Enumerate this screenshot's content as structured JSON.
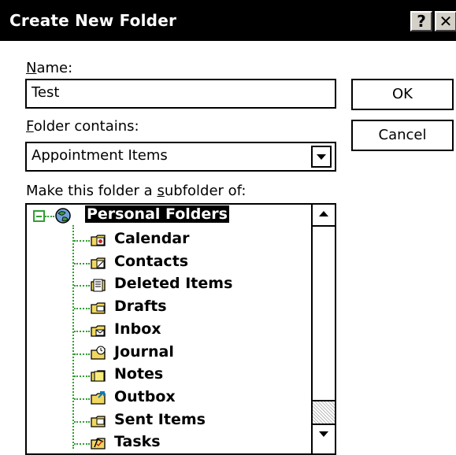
{
  "window": {
    "title": "Create New Folder",
    "help_glyph": "?",
    "close_glyph": "✕"
  },
  "name_field": {
    "label_accel": "N",
    "label_rest": "ame:",
    "value": "Test"
  },
  "contains": {
    "label_accel": "F",
    "label_rest": "older contains:",
    "value": "Appointment Items"
  },
  "subfolder": {
    "label_pre": "Make this folder a ",
    "label_accel": "s",
    "label_rest": "ubfolder of:"
  },
  "buttons": {
    "ok": "OK",
    "cancel": "Cancel"
  },
  "tree": {
    "root": {
      "label": "Personal Folders",
      "icon": "personal-folders-icon"
    },
    "items": [
      {
        "label": "Calendar",
        "icon": "calendar-icon"
      },
      {
        "label": "Contacts",
        "icon": "contacts-icon"
      },
      {
        "label": "Deleted Items",
        "icon": "deleted-items-icon"
      },
      {
        "label": "Drafts",
        "icon": "drafts-icon"
      },
      {
        "label": "Inbox",
        "icon": "inbox-icon"
      },
      {
        "label": "Journal",
        "icon": "journal-icon"
      },
      {
        "label": "Notes",
        "icon": "notes-icon"
      },
      {
        "label": "Outbox",
        "icon": "outbox-icon"
      },
      {
        "label": "Sent Items",
        "icon": "sent-items-icon"
      },
      {
        "label": "Tasks",
        "icon": "tasks-icon"
      }
    ]
  },
  "colors": {
    "title_bar": "#000000",
    "tree_lines": "#2fa02f",
    "folder": "#f0d860"
  }
}
